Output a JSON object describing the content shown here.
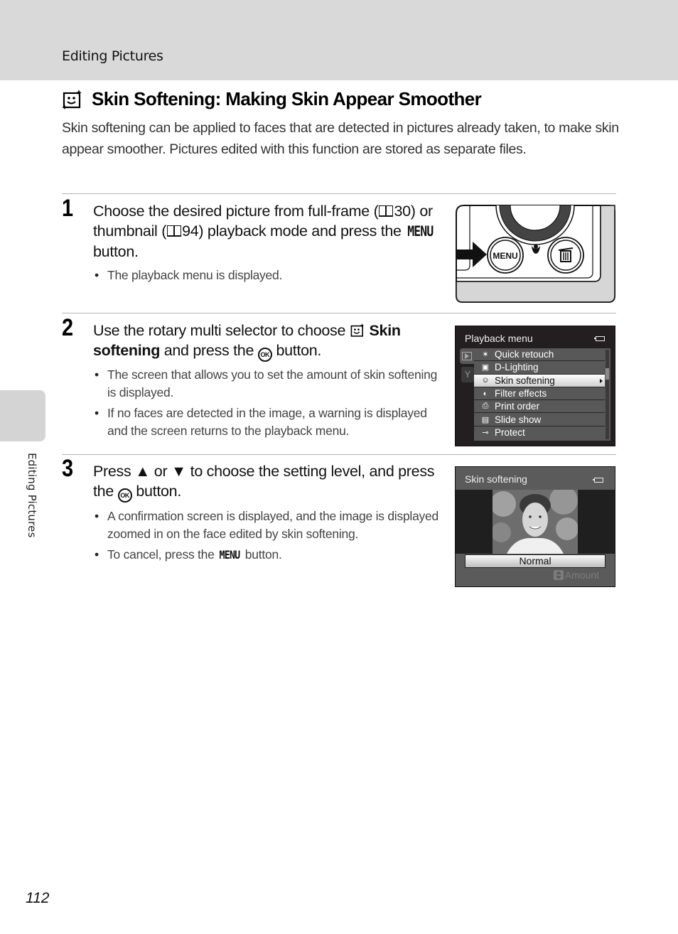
{
  "header": {
    "section": "Editing Pictures"
  },
  "side_tab": {
    "label": "Editing Pictures"
  },
  "title": {
    "icon": "skin-softening-icon",
    "text": "Skin Softening: Making Skin Appear Smoother"
  },
  "intro": "Skin softening can be applied to faces that are detected in pictures already taken, to make skin appear smoother. Pictures edited with this function are stored as separate files.",
  "steps": [
    {
      "number": "1",
      "head": {
        "part1": "Choose the desired picture from full-frame (",
        "ref1": "30",
        "part2": ") or thumbnail (",
        "ref2": "94",
        "part3": ") playback mode and press the ",
        "menu_word": "MENU",
        "part4": " button."
      },
      "bullets": [
        "The playback menu is displayed."
      ],
      "illustration": {
        "menu_button_label": "MENU",
        "icons": [
          "arrow-right-icon",
          "macro-flower-icon",
          "trash-icon"
        ]
      }
    },
    {
      "number": "2",
      "head": {
        "part1": "Use the rotary multi selector to choose ",
        "bold": "Skin softening",
        "part2": " and press the ",
        "ok_word": "OK",
        "part3": " button."
      },
      "bullets": [
        "The screen that allows you to set the amount of skin softening is displayed.",
        "If no faces are detected in the image, a warning is displayed and the screen returns to the playback menu."
      ],
      "screen": {
        "title": "Playback menu",
        "items": [
          {
            "icon": "quick-retouch-icon",
            "label": "Quick retouch",
            "selected": false
          },
          {
            "icon": "d-lighting-icon",
            "label": "D-Lighting",
            "selected": false
          },
          {
            "icon": "skin-softening-icon",
            "label": "Skin softening",
            "selected": true
          },
          {
            "icon": "filter-effects-icon",
            "label": "Filter effects",
            "selected": false
          },
          {
            "icon": "print-order-icon",
            "label": "Print order",
            "selected": false
          },
          {
            "icon": "slide-show-icon",
            "label": "Slide show",
            "selected": false
          },
          {
            "icon": "protect-key-icon",
            "label": "Protect",
            "selected": false
          }
        ]
      }
    },
    {
      "number": "3",
      "head": {
        "part1": "Press ",
        "up": "▲",
        "part2": " or ",
        "down": "▼",
        "part3": " to choose the setting level, and press the ",
        "ok_word": "OK",
        "part4": " button."
      },
      "bullets": [
        "A confirmation screen is displayed, and the image is displayed zoomed in on the face edited by skin softening.",
        {
          "pre": "To cancel, press the ",
          "menu_word": "MENU",
          "post": " button."
        }
      ],
      "screen": {
        "title": "Skin softening",
        "value": "Normal",
        "hint": "Amount"
      }
    }
  ],
  "page_number": "112"
}
